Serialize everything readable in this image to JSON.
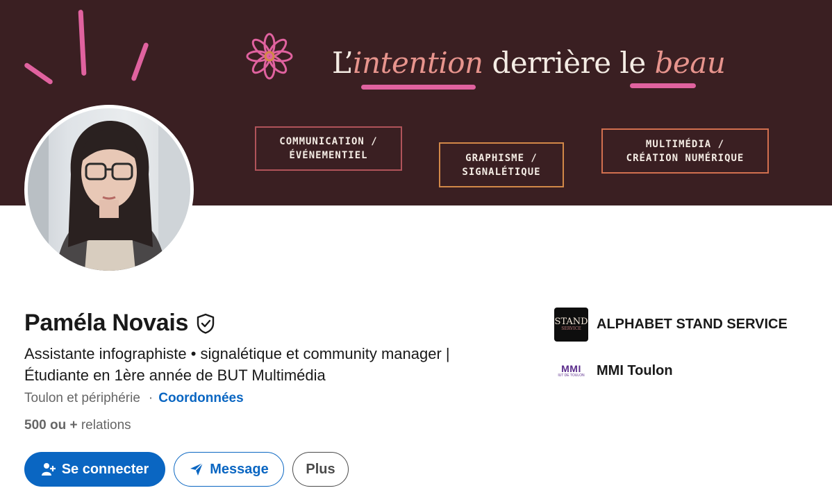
{
  "banner": {
    "headline": {
      "part1": "L’",
      "part2": "intention",
      "part3": " derrière le ",
      "part4": "beau"
    },
    "boxes": [
      {
        "line1": "COMMUNICATION /",
        "line2": "ÉVÉNEMENTIEL"
      },
      {
        "line1": "GRAPHISME /",
        "line2": "SIGNALÉTIQUE"
      },
      {
        "line1": "MULTIMÉDIA /",
        "line2": "CRÉATION NUMÉRIQUE"
      }
    ],
    "colors": {
      "background": "#3a1f22",
      "accent_pink": "#e0629f",
      "accent_peach": "#e7948d",
      "box_border_red": "#b0535a",
      "box_border_orange": "#d28848"
    }
  },
  "profile": {
    "name": "Paméla Novais",
    "verified_icon": "shield-check-icon",
    "headline_line1": "Assistante infographiste • signalétique et community manager |",
    "headline_line2": "Étudiante en 1ère année de BUT Multimédia",
    "location": "Toulon et périphérie",
    "separator": "·",
    "contact_link": "Coordonnées",
    "relations_count": "500 ou +",
    "relations_label": " relations"
  },
  "actions": {
    "connect": "Se connecter",
    "connect_icon": "add-person-icon",
    "message": "Message",
    "message_icon": "send-icon",
    "more": "Plus"
  },
  "sidebar": {
    "items": [
      {
        "logo_line1": "STAND",
        "logo_line2": "SERVICE",
        "label": "ALPHABET STAND SERVICE"
      },
      {
        "logo_line1": "MMI",
        "logo_line2": "IUT DE TOULON",
        "label": "MMI Toulon"
      }
    ]
  },
  "colors": {
    "primary": "#0a66c2",
    "text": "#191919",
    "muted": "#666666"
  }
}
